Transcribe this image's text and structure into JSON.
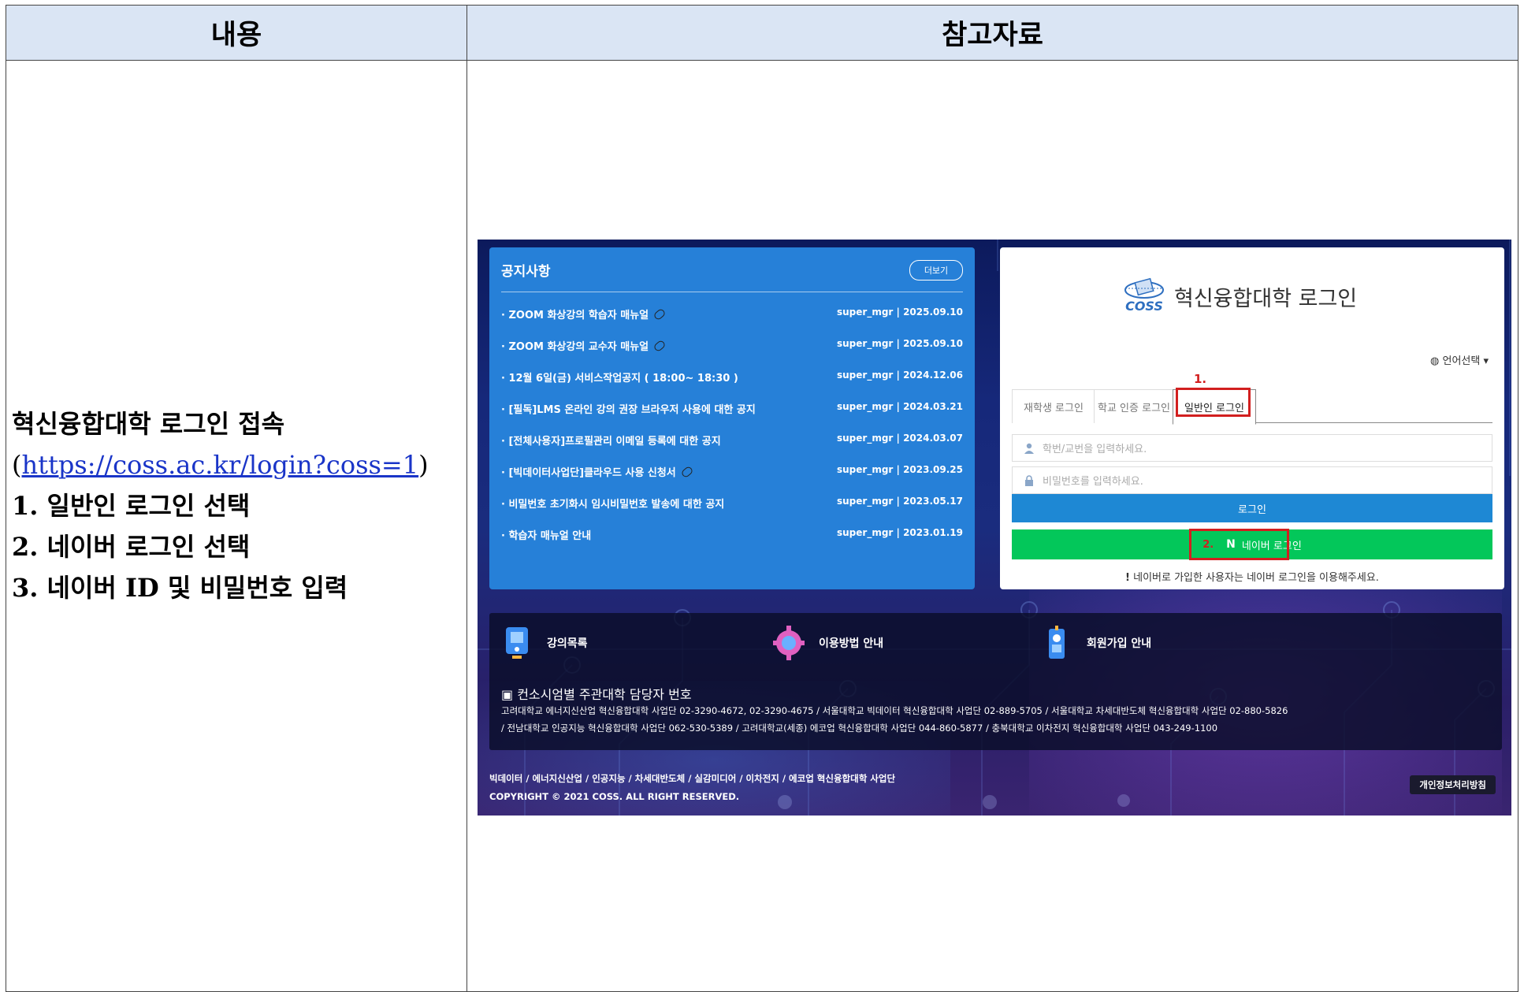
{
  "table": {
    "headers": [
      "내용",
      "참고자료"
    ]
  },
  "content": {
    "title_line": "혁신융합대학 로그인 접속",
    "url_open": "(",
    "url": "https://coss.ac.kr/login?coss=1",
    "url_close": ")",
    "steps": [
      "1. 일반인 로그인 선택",
      "2. 네이버 로그인 선택",
      "3. 네이버 ID 및 비밀번호 입력"
    ]
  },
  "screenshot": {
    "notice": {
      "title": "공지사항",
      "more_label": "더보기",
      "items": [
        {
          "title": "· ZOOM 화상강의 학습자 매뉴얼",
          "meta": "super_mgr | 2025.09.10",
          "attachment": true
        },
        {
          "title": "· ZOOM 화상강의 교수자 매뉴얼",
          "meta": "super_mgr | 2025.09.10",
          "attachment": true
        },
        {
          "title": "· 12월 6일(금) 서비스작업공지 ( 18:00~ 18:30 )",
          "meta": "super_mgr | 2024.12.06",
          "attachment": false
        },
        {
          "title": "· [필독]LMS 온라인 강의 권장 브라우저 사용에 대한 공지",
          "meta": "super_mgr | 2024.03.21",
          "attachment": false
        },
        {
          "title": "· [전체사용자]프로필관리 이메일 등록에 대한 공지",
          "meta": "super_mgr | 2024.03.07",
          "attachment": false
        },
        {
          "title": "· [빅데이터사업단]클라우드 사용 신청서",
          "meta": "super_mgr | 2023.09.25",
          "attachment": true
        },
        {
          "title": "· 비밀번호 초기화시 임시비밀번호 발송에 대한 공지",
          "meta": "super_mgr | 2023.05.17",
          "attachment": false
        },
        {
          "title": "· 학습자 매뉴얼 안내",
          "meta": "super_mgr | 2023.01.19",
          "attachment": false
        }
      ]
    },
    "login": {
      "title": "혁신융합대학 로그인",
      "logo_text": "COSS",
      "language_label": "언어선택",
      "step1": "1.",
      "step2": "2.",
      "tabs": [
        "재학생 로그인",
        "학교 인증 로그인",
        "일반인 로그인"
      ],
      "id_placeholder": "학번/교번을 입력하세요.",
      "pw_placeholder": "비밀번호를 입력하세요.",
      "login_button": "로그인",
      "naver_n": "N",
      "naver_button": "네이버 로그인",
      "naver_note_mark": "!",
      "naver_note": "네이버로 가입한 사용자는 네이버 로그인을 이용해주세요."
    },
    "footer": {
      "links": [
        "강의목록",
        "이용방법 안내",
        "회원가입 안내"
      ],
      "contact_title": "컨소시엄별 주관대학 담당자 번호",
      "contact_line1": "고려대학교 에너지신산업 혁신융합대학 사업단 02-3290-4672, 02-3290-4675 / 서울대학교 빅데이터 혁신융합대학 사업단 02-889-5705 / 서울대학교 차세대반도체 혁신융합대학 사업단 02-880-5826",
      "contact_line2": "/ 전남대학교 인공지능 혁신융합대학 사업단 062-530-5389 / 고려대학교(세종) 에코업 혁신융합대학 사업단 044-860-5877 / 충북대학교 이차전지 혁신융합대학 사업단 043-249-1100",
      "bottom_links": "빅데이터 / 에너지신산업 / 인공지능 / 차세대반도체 / 실감미디어 / 이차전지 / 에코업 혁신융합대학 사업단",
      "copyright": "COPYRIGHT © 2021 COSS. ALL RIGHT RESERVED.",
      "privacy": "개인정보처리방침"
    }
  },
  "colors": {
    "header_bg": "#dae5f4",
    "notice_bg": "#2680d8",
    "login_button": "#1e88d4",
    "naver_button": "#03c75a",
    "highlight": "#d21f1f",
    "link": "#1a35c8"
  }
}
